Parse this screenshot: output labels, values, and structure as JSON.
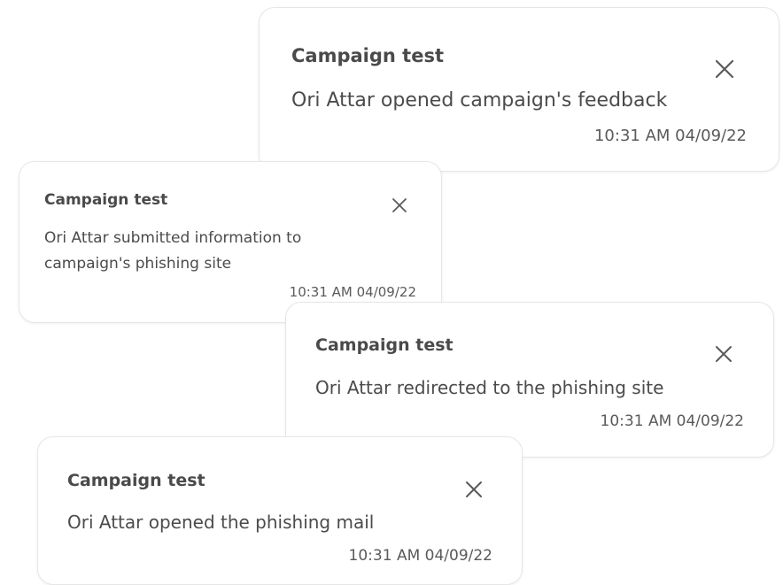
{
  "notifications": [
    {
      "title": "Campaign test",
      "message": "Ori Attar opened campaign's feedback",
      "time": "10:31 AM 04/09/22",
      "close_icon": "close-icon"
    },
    {
      "title": "Campaign test",
      "message": "Ori Attar submitted information to campaign's phishing site",
      "time": "10:31 AM 04/09/22",
      "close_icon": "close-icon"
    },
    {
      "title": "Campaign test",
      "message": "Ori Attar redirected to the phishing site",
      "time": "10:31 AM 04/09/22",
      "close_icon": "close-icon"
    },
    {
      "title": "Campaign test",
      "message": "Ori Attar opened the phishing mail",
      "time": "10:31 AM 04/09/22",
      "close_icon": "close-icon"
    }
  ],
  "colors": {
    "card_background": "#ffffff",
    "card_border": "#e6e6e6",
    "text": "#4b4b4b",
    "close_icon": "#5a5a5a"
  }
}
